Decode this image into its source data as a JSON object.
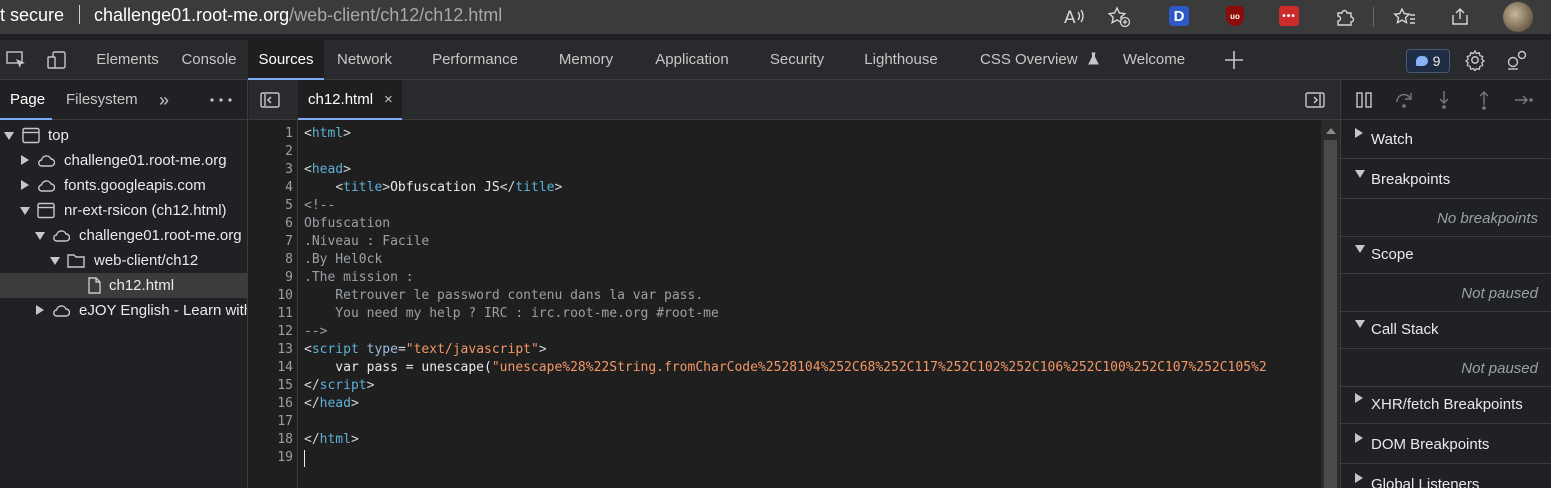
{
  "browser": {
    "security_text": "t secure",
    "url_host": "challenge01.root-me.org",
    "url_path": "/web-client/ch12/ch12.html",
    "extensions": [
      {
        "name": "D"
      },
      {
        "name": "uo"
      },
      {
        "name": "•••"
      }
    ]
  },
  "devtools": {
    "tabs": [
      "Elements",
      "Console",
      "Sources",
      "Network",
      "Performance",
      "Memory",
      "Application",
      "Security",
      "Lighthouse",
      "CSS Overview",
      "Welcome"
    ],
    "active_tab": "Sources",
    "issues_count": "9"
  },
  "navigator": {
    "tabs": [
      "Page",
      "Filesystem"
    ],
    "more_symbol": "»",
    "menu_symbol": "⋮",
    "tree": [
      {
        "label": "top"
      },
      {
        "label": "challenge01.root-me.org"
      },
      {
        "label": "fonts.googleapis.com"
      },
      {
        "label": "nr-ext-rsicon (ch12.html)"
      },
      {
        "label": "challenge01.root-me.org"
      },
      {
        "label": "web-client/ch12"
      },
      {
        "label": "ch12.html"
      },
      {
        "label": "eJOY English - Learn with"
      }
    ]
  },
  "editor": {
    "file_tab": "ch12.html",
    "close_symbol": "×",
    "line_numbers": [
      "1",
      "2",
      "3",
      "4",
      "5",
      "6",
      "7",
      "8",
      "9",
      "10",
      "11",
      "12",
      "13",
      "14",
      "15",
      "16",
      "17",
      "18",
      "19"
    ],
    "code": {
      "l1_tag": "html",
      "l3_tag": "head",
      "l4_tag_open": "title",
      "l4_text": "Obfuscation JS",
      "l4_tag_close": "title",
      "l5": "<!--",
      "l6": "Obfuscation",
      "l7": ".Niveau : Facile",
      "l8": ".By Hel0ck",
      "l9": ".The mission :",
      "l10": "    Retrouver le password contenu dans la var pass.",
      "l11": "    You need my help ? IRC : irc.root-me.org #root-me",
      "l12": "-->",
      "l13_tag": "script",
      "l13_attr": "type",
      "l13_value": "\"text/javascript\"",
      "l14_prefix": "    var pass = unescape(",
      "l14_string": "\"unescape%28%22String.fromCharCode%2528104%252C68%252C117%252C102%252C106%252C100%252C107%252C105%2",
      "l15_tag": "script",
      "l16_tag": "head",
      "l18_tag": "html"
    }
  },
  "debugger": {
    "panes": [
      {
        "title": "Watch"
      },
      {
        "title": "Breakpoints",
        "body": "No breakpoints"
      },
      {
        "title": "Scope",
        "body": "Not paused"
      },
      {
        "title": "Call Stack",
        "body": "Not paused"
      },
      {
        "title": "XHR/fetch Breakpoints"
      },
      {
        "title": "DOM Breakpoints"
      },
      {
        "title": "Global Listeners"
      }
    ]
  }
}
